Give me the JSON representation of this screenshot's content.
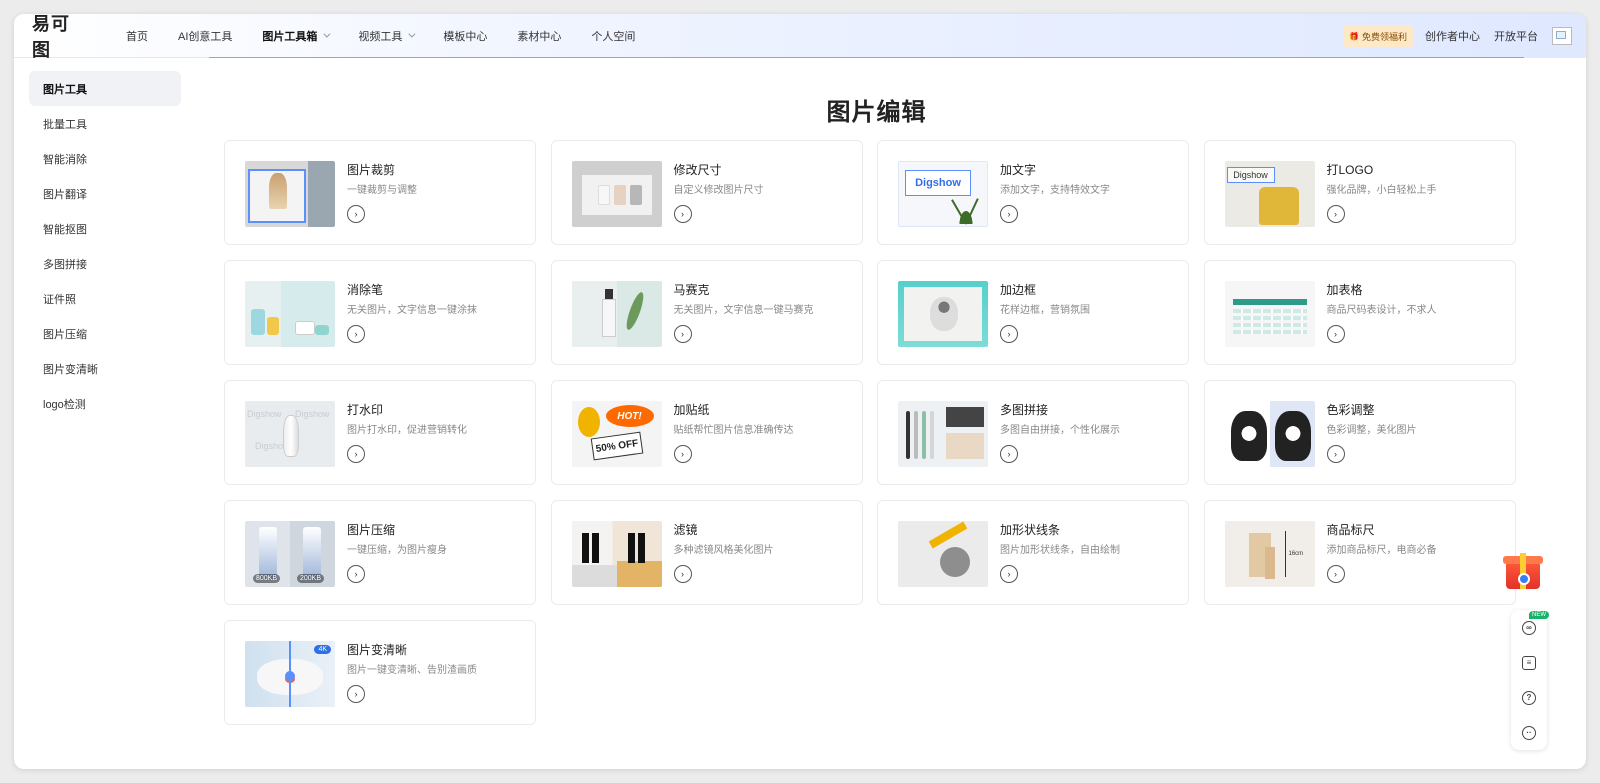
{
  "header": {
    "logo": "易可图",
    "nav": [
      {
        "label": "首页",
        "active": false,
        "dropdown": false
      },
      {
        "label": "AI创意工具",
        "active": false,
        "dropdown": false
      },
      {
        "label": "图片工具箱",
        "active": true,
        "dropdown": true
      },
      {
        "label": "视频工具",
        "active": false,
        "dropdown": true
      },
      {
        "label": "模板中心",
        "active": false,
        "dropdown": false
      },
      {
        "label": "素材中心",
        "active": false,
        "dropdown": false
      },
      {
        "label": "个人空间",
        "active": false,
        "dropdown": false
      }
    ],
    "promo": "免费领福利",
    "links": [
      "创作者中心",
      "开放平台"
    ]
  },
  "sidebar": {
    "items": [
      "图片工具",
      "批量工具",
      "智能消除",
      "图片翻译",
      "智能抠图",
      "多图拼接",
      "证件照",
      "图片压缩",
      "图片变清晰",
      "logo检测"
    ],
    "active_index": 0
  },
  "main": {
    "title": "图片编辑",
    "cards": [
      {
        "title": "图片裁剪",
        "desc": "一键裁剪与调整",
        "thumb": "crop"
      },
      {
        "title": "修改尺寸",
        "desc": "自定义修改图片尺寸",
        "thumb": "resize"
      },
      {
        "title": "加文字",
        "desc": "添加文字，支持特效文字",
        "thumb": "text",
        "thumb_text": "Digshow"
      },
      {
        "title": "打LOGO",
        "desc": "强化品牌，小白轻松上手",
        "thumb": "logo",
        "thumb_text": "Digshow"
      },
      {
        "title": "消除笔",
        "desc": "无关图片，文字信息一键涂抹",
        "thumb": "eraser"
      },
      {
        "title": "马赛克",
        "desc": "无关图片，文字信息一键马赛克",
        "thumb": "mosaic"
      },
      {
        "title": "加边框",
        "desc": "花样边框，营销氛围",
        "thumb": "border"
      },
      {
        "title": "加表格",
        "desc": "商品尺码表设计，不求人",
        "thumb": "table"
      },
      {
        "title": "打水印",
        "desc": "图片打水印，促进营销转化",
        "thumb": "watermark",
        "thumb_text": "Digshow"
      },
      {
        "title": "加贴纸",
        "desc": "贴纸帮忙图片信息准确传达",
        "thumb": "sticker",
        "thumb_text": "HOT!",
        "thumb_text2": "50% OFF"
      },
      {
        "title": "多图拼接",
        "desc": "多图自由拼接，个性化展示",
        "thumb": "collage"
      },
      {
        "title": "色彩调整",
        "desc": "色彩调整，美化图片",
        "thumb": "color"
      },
      {
        "title": "图片压缩",
        "desc": "一键压缩，为图片瘦身",
        "thumb": "compress",
        "thumb_text": "800KB",
        "thumb_text2": "200KB"
      },
      {
        "title": "滤镜",
        "desc": "多种滤镜风格美化图片",
        "thumb": "filter"
      },
      {
        "title": "加形状线条",
        "desc": "图片加形状线条，自由绘制",
        "thumb": "shape"
      },
      {
        "title": "商品标尺",
        "desc": "添加商品标尺，电商必备",
        "thumb": "ruler",
        "thumb_text": "16cm"
      },
      {
        "title": "图片变清晰",
        "desc": "图片一键变清晰、告别渣画质",
        "thumb": "enhance",
        "thumb_text": "4K"
      }
    ]
  },
  "floating": {
    "new_badge": "NEW",
    "tools": [
      "link-icon",
      "note-icon",
      "help-icon",
      "chat-icon"
    ]
  }
}
